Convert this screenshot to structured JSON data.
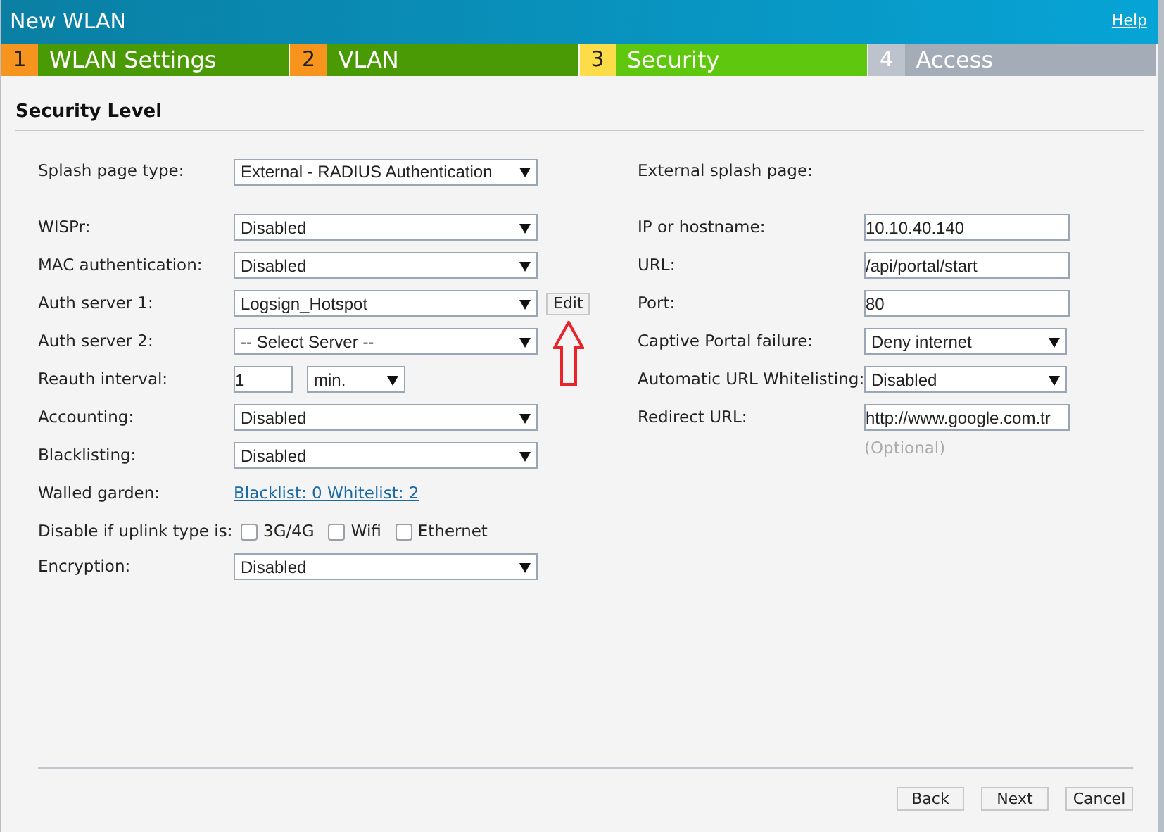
{
  "window": {
    "title": "New WLAN",
    "help": "Help"
  },
  "steps": [
    {
      "number": "1",
      "label": "WLAN Settings",
      "kind": "done"
    },
    {
      "number": "2",
      "label": "VLAN",
      "kind": "done"
    },
    {
      "number": "3",
      "label": "Security",
      "kind": "current"
    },
    {
      "number": "4",
      "label": "Access",
      "kind": "todo"
    }
  ],
  "section_title": "Security Level",
  "left_fields": [
    {
      "kind": "select",
      "label": "Splash page type:",
      "value": "External - RADIUS Authentication"
    },
    {
      "kind": "select",
      "label": "WISPr:",
      "value": "Disabled"
    },
    {
      "kind": "select",
      "label": "MAC authentication:",
      "value": "Disabled"
    },
    {
      "kind": "select",
      "label": "Auth server 1:",
      "value": "Logsign_Hotspot",
      "button": "Edit"
    },
    {
      "kind": "select",
      "label": "Auth server 2:",
      "value": "-- Select Server --"
    },
    {
      "kind": "interval",
      "label": "Reauth interval:",
      "value": "1",
      "unit": "min."
    },
    {
      "kind": "select",
      "label": "Accounting:",
      "value": "Disabled"
    },
    {
      "kind": "select",
      "label": "Blacklisting:",
      "value": "Disabled"
    },
    {
      "kind": "link",
      "label": "Walled garden:",
      "value": "Blacklist: 0 Whitelist: 2"
    },
    {
      "kind": "checkboxes",
      "label": "Disable if uplink type is:",
      "options": [
        {
          "label": "3G/4G",
          "checked": false
        },
        {
          "label": "Wifi",
          "checked": false
        },
        {
          "label": "Ethernet",
          "checked": false
        }
      ]
    },
    {
      "kind": "select",
      "label": "Encryption:",
      "value": "Disabled"
    }
  ],
  "right_fields": [
    {
      "kind": "heading",
      "label": "External splash page:"
    },
    {
      "kind": "input",
      "label": "IP or hostname:",
      "value": "10.10.40.140"
    },
    {
      "kind": "input",
      "label": "URL:",
      "value": "/api/portal/start"
    },
    {
      "kind": "input",
      "label": "Port:",
      "value": "80"
    },
    {
      "kind": "select",
      "label": "Captive Portal failure:",
      "value": "Deny internet"
    },
    {
      "kind": "select",
      "label": "Automatic URL Whitelisting:",
      "value": "Disabled"
    },
    {
      "kind": "input",
      "label": "Redirect URL:",
      "value": "http://www.google.com.tr",
      "hint": "(Optional)"
    }
  ],
  "buttons": [
    "Back",
    "Next",
    "Cancel"
  ]
}
